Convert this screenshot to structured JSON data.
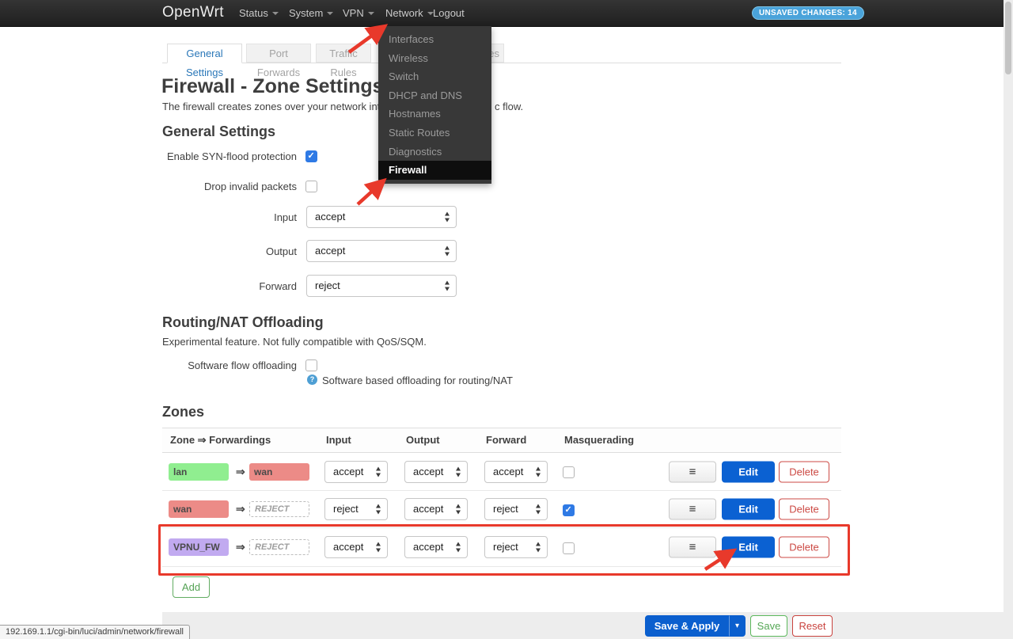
{
  "navbar": {
    "brand": "OpenWrt",
    "menus": [
      "Status",
      "System",
      "VPN",
      "Network"
    ],
    "logout": "Logout",
    "unsaved_badge": "UNSAVED CHANGES: 14",
    "badge_color": "#4aa3da"
  },
  "network_dropdown": {
    "items": [
      "Interfaces",
      "Wireless",
      "Switch",
      "DHCP and DNS",
      "Hostnames",
      "Static Routes",
      "Diagnostics",
      "Firewall"
    ],
    "active_item": "Firewall"
  },
  "tabs": {
    "items": [
      "General Settings",
      "Port Forwards",
      "Traffic Rules"
    ],
    "active": "General Settings",
    "partial_last_tab": "es"
  },
  "page": {
    "title": "Firewall - Zone Settings",
    "subtitle_visible_left": "The firewall creates zones over your network interfa",
    "subtitle_visible_right": "c flow."
  },
  "general_settings": {
    "heading": "General Settings",
    "syn_flood": {
      "label": "Enable SYN-flood protection",
      "checked": true
    },
    "drop_invalid": {
      "label": "Drop invalid packets",
      "checked": false
    },
    "input": {
      "label": "Input",
      "value": "accept"
    },
    "output": {
      "label": "Output",
      "value": "accept"
    },
    "forward": {
      "label": "Forward",
      "value": "reject"
    }
  },
  "routing_nat": {
    "heading": "Routing/NAT Offloading",
    "description": "Experimental feature. Not fully compatible with QoS/SQM.",
    "flow_offloading": {
      "label": "Software flow offloading",
      "checked": false,
      "help_text": "Software based offloading for routing/NAT"
    }
  },
  "zones": {
    "heading": "Zones",
    "columns": [
      "Zone ⇒ Forwardings",
      "Input",
      "Output",
      "Forward",
      "Masquerading"
    ],
    "arrow_glyph": "⇒",
    "zone_colors": {
      "lan": "#90ee90",
      "wan": "#ec8b87",
      "VPNU_FW": "#c1aaf0"
    },
    "rows": [
      {
        "zone": "lan",
        "target": "wan",
        "target_is_reject": false,
        "input": "accept",
        "output": "accept",
        "forward": "accept",
        "masquerading": false
      },
      {
        "zone": "wan",
        "target": "REJECT",
        "target_is_reject": true,
        "input": "reject",
        "output": "accept",
        "forward": "reject",
        "masquerading": true
      },
      {
        "zone": "VPNU_FW",
        "target": "REJECT",
        "target_is_reject": true,
        "input": "accept",
        "output": "accept",
        "forward": "reject",
        "masquerading": false
      }
    ],
    "row_actions": {
      "menu_icon": "≡",
      "edit": "Edit",
      "delete": "Delete"
    },
    "add_button": "Add"
  },
  "footer": {
    "save_apply": "Save & Apply",
    "caret": "▾",
    "save": "Save",
    "reset": "Reset"
  },
  "status_tooltip": "192.169.1.1/cgi-bin/luci/admin/network/firewall",
  "annotation_color": "#e8392b"
}
